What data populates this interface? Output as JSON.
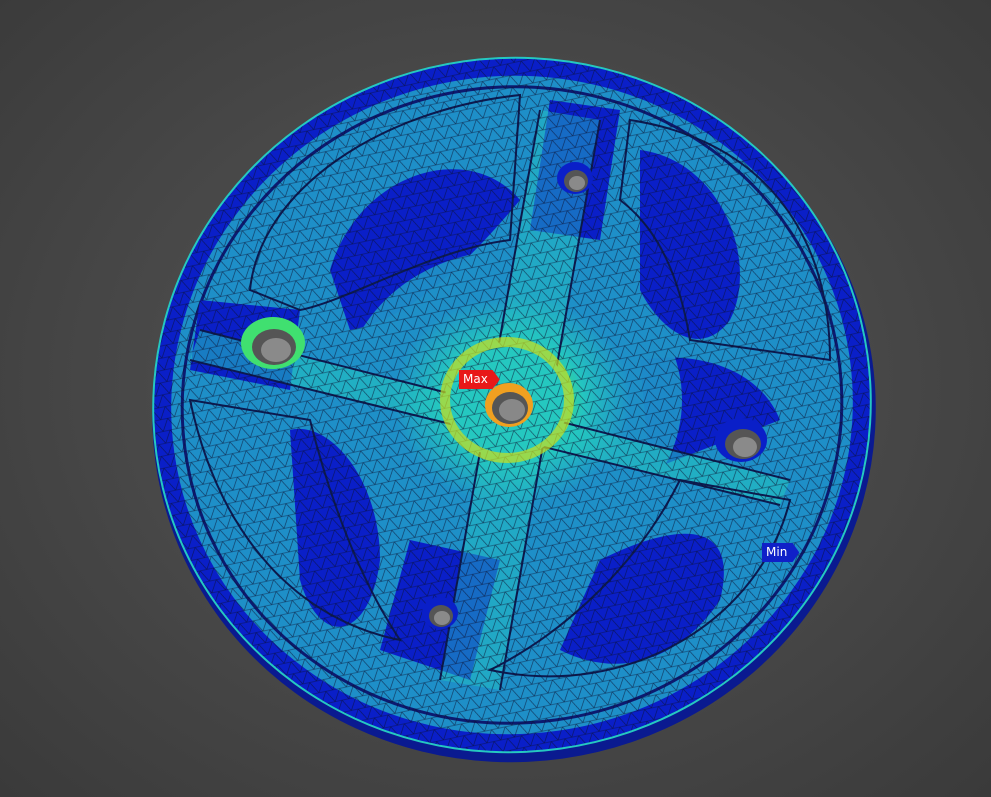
{
  "viewport": {
    "background_color": "#4a4a4a"
  },
  "model": {
    "description_icon": "fea-stress-contour-plot",
    "contour_colors": {
      "minimum": "#0a1fc8",
      "low": "#1e90c8",
      "mid_low": "#25c8c0",
      "mid": "#40e070",
      "high": "#c8e020",
      "very_high": "#f0a020",
      "maximum": "#e81010"
    },
    "mesh_color": "#0b1030"
  },
  "probes": {
    "max": {
      "label": "Max",
      "color": "#e81818"
    },
    "min": {
      "label": "Min",
      "color": "#1020c8"
    }
  }
}
